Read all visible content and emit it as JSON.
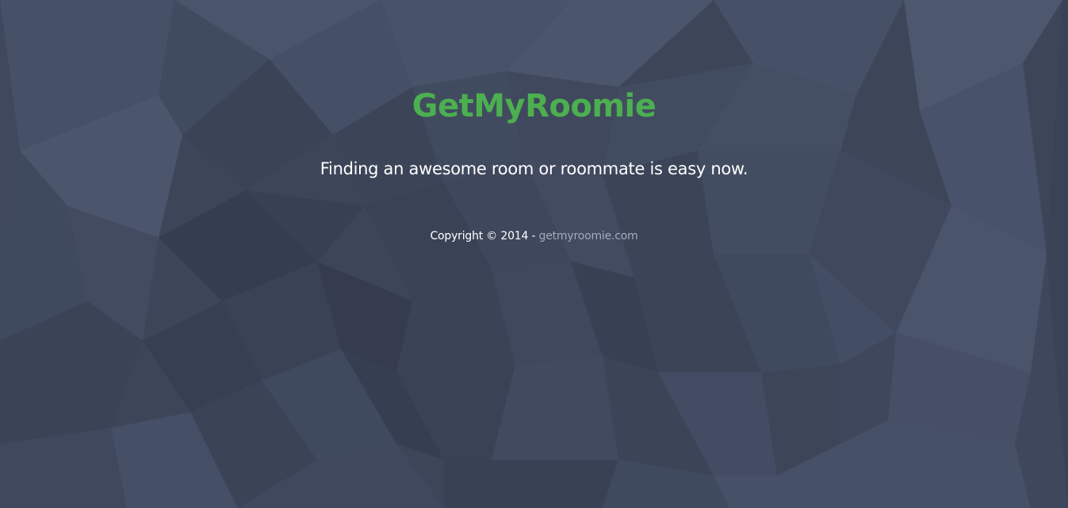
{
  "brand": {
    "name": "GetMyRoomie",
    "color": "#4caf50"
  },
  "hero": {
    "tagline": "Finding an awesome room or roommate is easy now."
  },
  "footer": {
    "copyright_text": "Copyright © 2014 - ",
    "link_text": "getmyroomie.com",
    "text_color": "#ffffff",
    "link_color": "#a3acbb"
  },
  "colors": {
    "background": "#3d4659"
  }
}
